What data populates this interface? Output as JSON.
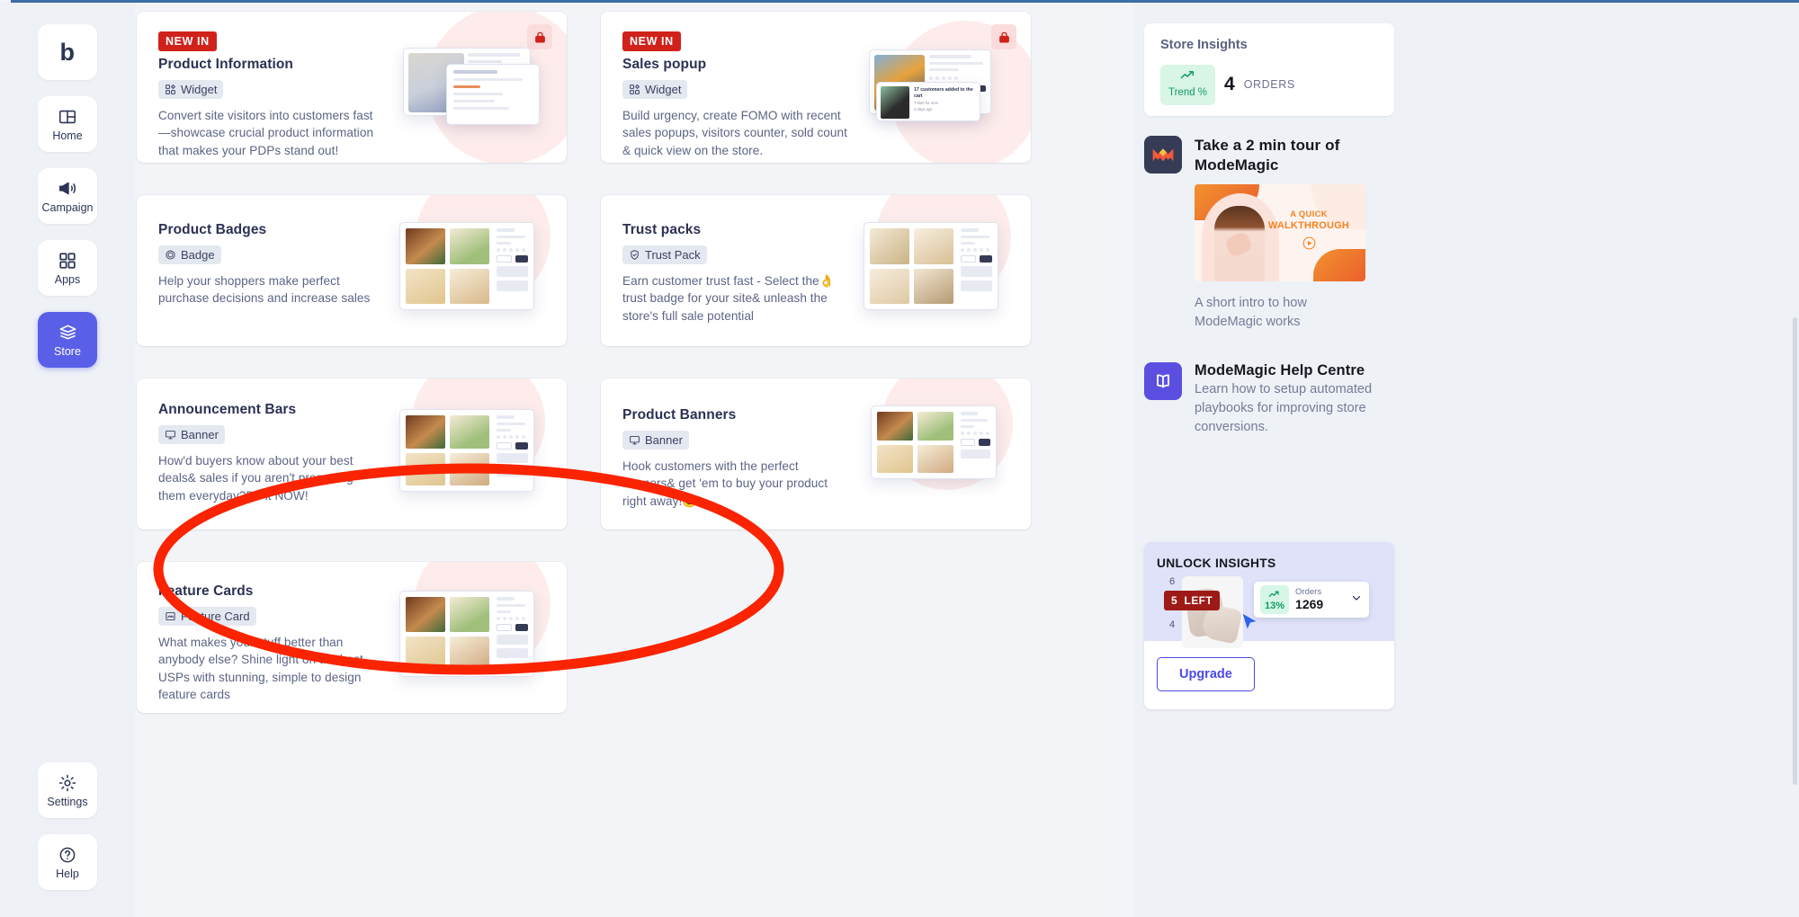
{
  "sidebar": {
    "logo": "b",
    "items": [
      {
        "label": "Home",
        "icon": "layout-icon",
        "active": false
      },
      {
        "label": "Campaign",
        "icon": "megaphone-icon",
        "active": false
      },
      {
        "label": "Apps",
        "icon": "grid-icon",
        "active": false
      },
      {
        "label": "Store",
        "icon": "store-icon",
        "active": true
      }
    ],
    "bottom_items": [
      {
        "label": "Settings",
        "icon": "gear-icon"
      },
      {
        "label": "Help",
        "icon": "question-circle-icon"
      }
    ]
  },
  "cards": [
    {
      "badge": "NEW IN",
      "title": "Product Information",
      "tag": "Widget",
      "tag_icon": "widget-icon",
      "description": "Convert site visitors into customers fast—showcase crucial product information that makes your PDPs stand out!",
      "locked": true
    },
    {
      "badge": "NEW IN",
      "title": "Sales popup",
      "tag": "Widget",
      "tag_icon": "widget-icon",
      "description": "Build urgency, create FOMO with recent sales popups, visitors counter, sold count & quick view on the store.",
      "locked": true
    },
    {
      "badge": "",
      "title": "Product Badges",
      "tag": "Badge",
      "tag_icon": "badge-icon",
      "description": "Help your shoppers make perfect purchase decisions and increase sales",
      "locked": false
    },
    {
      "badge": "",
      "title": "Trust packs",
      "tag": "Trust Pack",
      "tag_icon": "shield-check-icon",
      "description": "Earn customer trust fast - Select the👌 trust badge for your site& unleash the store's full sale potential",
      "locked": false
    },
    {
      "badge": "",
      "title": "Announcement Bars",
      "tag": "Banner",
      "tag_icon": "monitor-icon",
      "description": "How'd buyers know about your best deals& sales if you aren't promoting them everyday?Do it NOW!",
      "locked": false,
      "highlighted": true
    },
    {
      "badge": "",
      "title": "Product Banners",
      "tag": "Banner",
      "tag_icon": "monitor-icon",
      "description": "Hook customers with the perfect banners& get 'em to buy your product right away!😊",
      "locked": false
    },
    {
      "badge": "",
      "title": "Feature Cards",
      "tag": "Feature Card",
      "tag_icon": "image-card-icon",
      "description": "What makes your stuff better than anybody else? Shine light on the best USPs with stunning, simple to design feature cards",
      "locked": false
    }
  ],
  "store_insights": {
    "title": "Store Insights",
    "trend_label": "Trend %",
    "orders_value": "4",
    "orders_label": "ORDERS"
  },
  "promo": {
    "heading": "Take a 2 min tour of ModeMagic",
    "thumb_line1": "A QUICK",
    "thumb_line2": "WALKTHROUGH",
    "subtitle": "A short intro to how ModeMagic works"
  },
  "help": {
    "heading": "ModeMagic Help Centre",
    "body": "Learn how to setup automated playbooks for improving store conversions."
  },
  "unlock": {
    "title": "UNLOCK INSIGHTS",
    "axis_high": "6",
    "axis_low": "4",
    "left_count": "5",
    "left_word": "LEFT",
    "orders_pct": "13%",
    "orders_label": "Orders",
    "orders_value": "1269",
    "upgrade_label": "Upgrade"
  },
  "colors": {
    "accent": "#5a5fe8",
    "danger": "#d0221b",
    "annotation": "#fa2400",
    "success": "#0f9d63"
  }
}
